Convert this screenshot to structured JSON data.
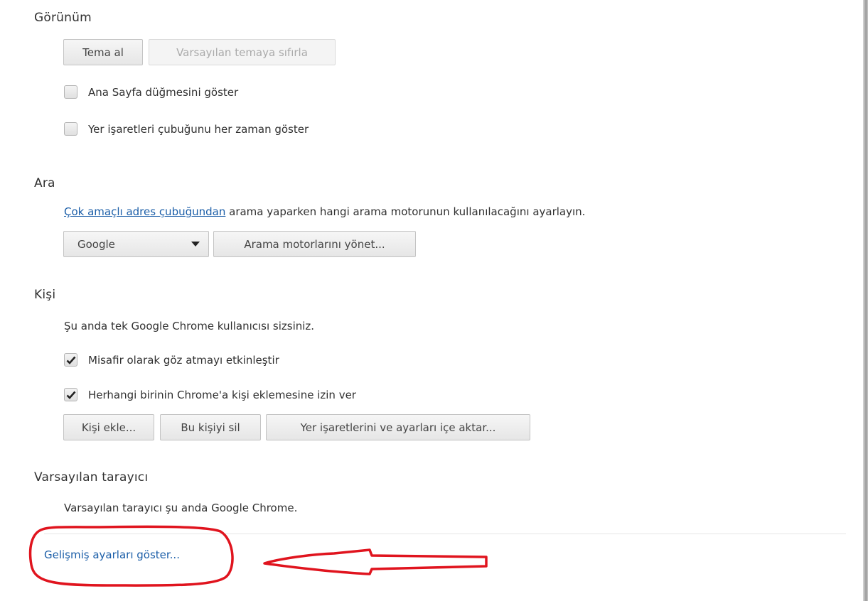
{
  "appearance": {
    "title": "Görünüm",
    "get_theme_button": "Tema al",
    "reset_theme_button": "Varsayılan temaya sıfırla",
    "show_home_button_label": "Ana Sayfa düğmesini göster",
    "show_home_button_checked": false,
    "show_bookmarks_bar_label": "Yer işaretleri çubuğunu her zaman göster",
    "show_bookmarks_bar_checked": false
  },
  "search": {
    "title": "Ara",
    "description_link": "Çok amaçlı adres çubuğundan",
    "description_rest": " arama yaparken hangi arama motorunun kullanılacağını ayarlayın.",
    "engine_selected": "Google",
    "manage_engines_button": "Arama motorlarını yönet..."
  },
  "people": {
    "title": "Kişi",
    "description": "Şu anda tek Google Chrome kullanıcısı sizsiniz.",
    "guest_browsing_label": "Misafir olarak göz atmayı etkinleştir",
    "guest_browsing_checked": true,
    "allow_add_person_label": "Herhangi birinin Chrome'a kişi eklemesine izin ver",
    "allow_add_person_checked": true,
    "add_person_button": "Kişi ekle...",
    "delete_person_button": "Bu kişiyi sil",
    "import_button": "Yer işaretlerini ve ayarları içe aktar..."
  },
  "default_browser": {
    "title": "Varsayılan tarayıcı",
    "description": "Varsayılan tarayıcı şu anda Google Chrome."
  },
  "footer": {
    "show_advanced_link": "Gelişmiş ayarları göster..."
  },
  "colors": {
    "link": "#1b5ea8",
    "annotation": "#e0141e"
  }
}
